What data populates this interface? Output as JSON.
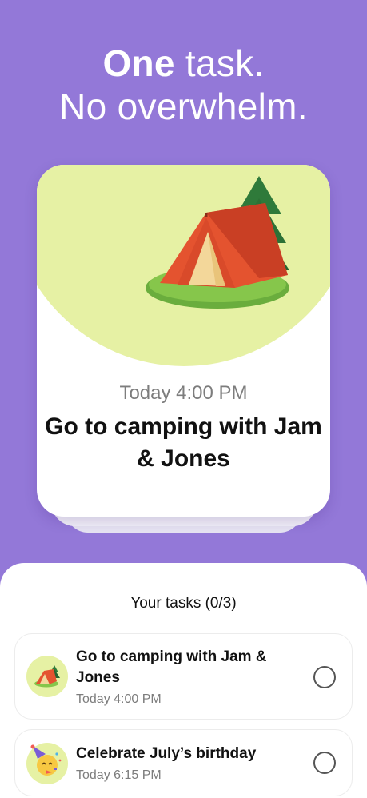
{
  "headline": {
    "bold": "One",
    "rest_line1": " task.",
    "line2": "No overwhelm."
  },
  "hero": {
    "time": "Today 4:00 PM",
    "title": "Go to camping with Jam & Jones",
    "icon": "camping-tent-icon",
    "accent_color": "#e6f1a4"
  },
  "sheet": {
    "title": "Your tasks (0/3)",
    "tasks": [
      {
        "title": "Go to camping with Jam & Jones",
        "time": "Today 4:00 PM",
        "icon": "camping-tent-icon",
        "completed": false
      },
      {
        "title": "Celebrate July’s birthday",
        "time": "Today 6:15 PM",
        "icon": "party-face-icon",
        "completed": false
      }
    ]
  },
  "colors": {
    "background": "#9378d8",
    "card": "#ffffff",
    "accent": "#e6f1a4"
  }
}
